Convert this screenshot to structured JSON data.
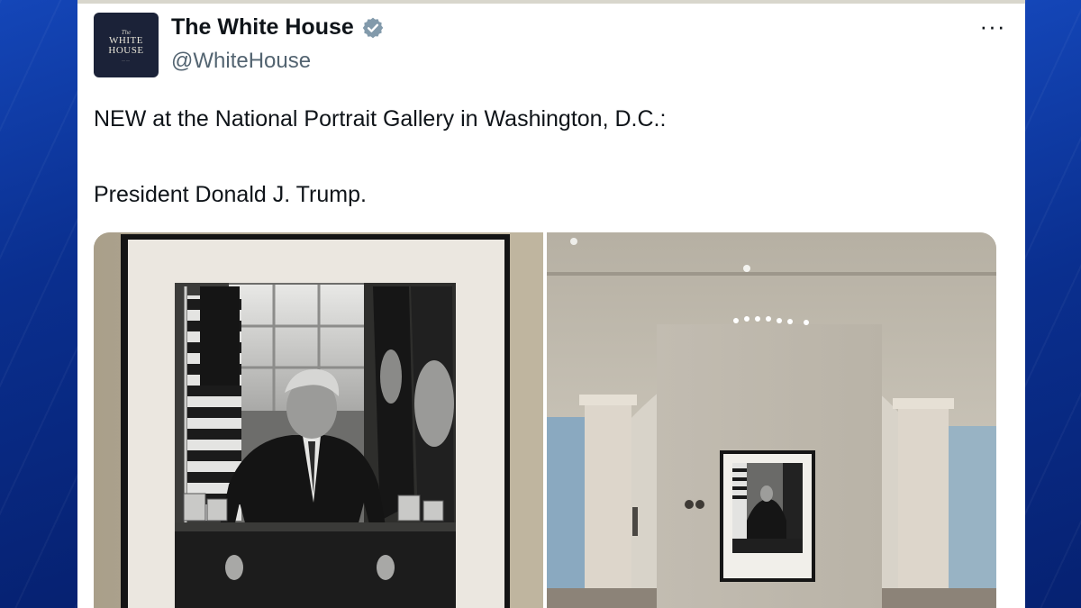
{
  "tweet": {
    "author": {
      "display_name": "The White House",
      "handle": "@WhiteHouse",
      "verified": true,
      "avatar_logo": {
        "line1": "The",
        "line2": "WHITE",
        "line3": "HOUSE"
      },
      "verified_icon": "verified-badge-icon"
    },
    "more_icon": "more-options-icon",
    "text_lines": [
      "NEW at the National Portrait Gallery in Washington, D.C.:",
      "President Donald J. Trump."
    ],
    "media": [
      {
        "kind": "photo",
        "depicts": "framed-portrait-closeup"
      },
      {
        "kind": "photo",
        "depicts": "gallery-wall-with-portrait"
      }
    ]
  },
  "colors": {
    "background_blue": "#0b2a7a",
    "card": "#ffffff",
    "text": "#0f1419",
    "handle": "#536471",
    "verified": "#829aab"
  }
}
